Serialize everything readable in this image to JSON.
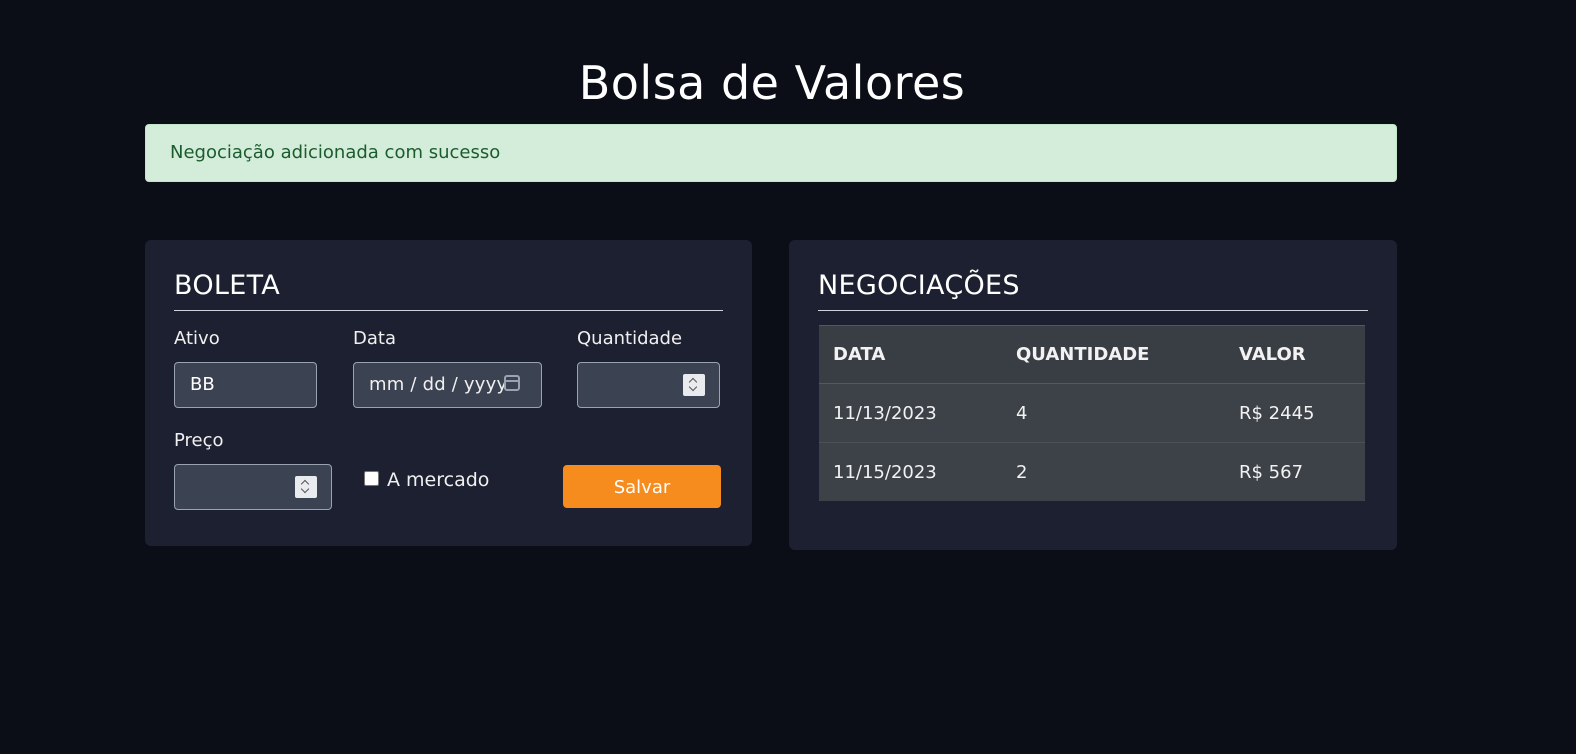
{
  "header": {
    "title": "Bolsa de Valores"
  },
  "alert": {
    "message": "Negociação adicionada com sucesso",
    "color": "#d4eddb"
  },
  "boleta": {
    "title": "BOLETA",
    "ativo": {
      "label": "Ativo",
      "value": "BB"
    },
    "data": {
      "label": "Data",
      "placeholder": "mm / dd / yyyy"
    },
    "quantidade": {
      "label": "Quantidade",
      "value": ""
    },
    "preco": {
      "label": "Preço",
      "value": ""
    },
    "mercado": {
      "label": "A mercado",
      "checked": false
    },
    "save_label": "Salvar",
    "save_color": "#f68c1e"
  },
  "negociacoes": {
    "title": "NEGOCIAÇÕES",
    "columns": [
      "DATA",
      "QUANTIDADE",
      "VALOR"
    ],
    "rows": [
      {
        "data": "11/13/2023",
        "quantidade": "4",
        "valor": "R$ 2445"
      },
      {
        "data": "11/15/2023",
        "quantidade": "2",
        "valor": "R$ 567"
      }
    ]
  }
}
